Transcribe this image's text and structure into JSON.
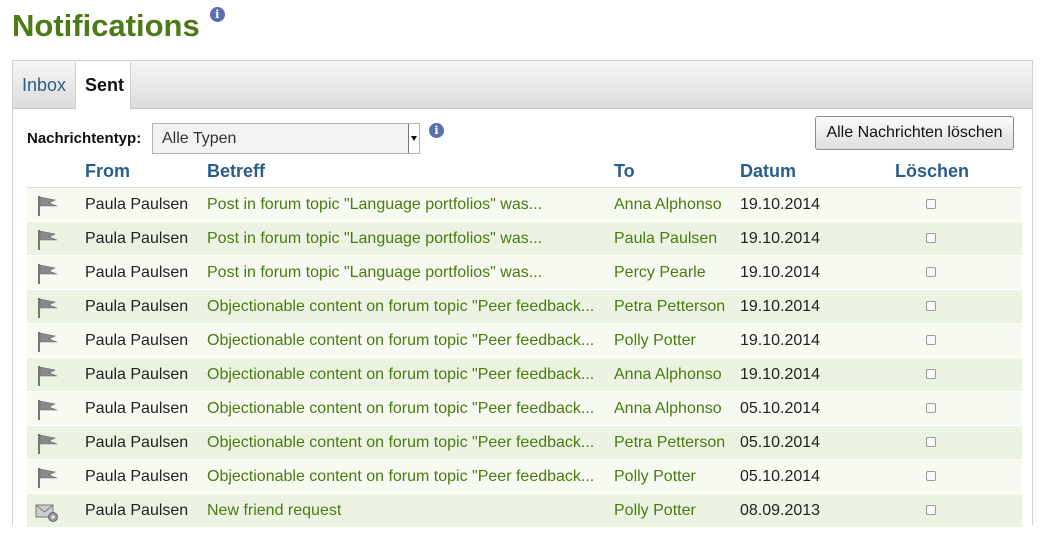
{
  "page": {
    "title": "Notifications"
  },
  "tabs": [
    {
      "label": "Inbox",
      "active": false
    },
    {
      "label": "Sent",
      "active": true
    }
  ],
  "filter": {
    "label": "Nachrichtentyp:",
    "selected": "Alle Typen"
  },
  "actions": {
    "delete_all_label": "Alle Nachrichten löschen"
  },
  "table": {
    "headers": {
      "from": "From",
      "subject": "Betreff",
      "to": "To",
      "date": "Datum",
      "delete": "Löschen"
    },
    "rows": [
      {
        "icon": "flag-icon",
        "from": "Paula Paulsen",
        "subject": "Post in forum topic \"Language portfolios\" was...",
        "to": "Anna Alphonso",
        "date": "19.10.2014"
      },
      {
        "icon": "flag-icon",
        "from": "Paula Paulsen",
        "subject": "Post in forum topic \"Language portfolios\" was...",
        "to": "Paula Paulsen",
        "date": "19.10.2014"
      },
      {
        "icon": "flag-icon",
        "from": "Paula Paulsen",
        "subject": "Post in forum topic \"Language portfolios\" was...",
        "to": "Percy Pearle",
        "date": "19.10.2014"
      },
      {
        "icon": "flag-icon",
        "from": "Paula Paulsen",
        "subject": "Objectionable content on forum topic \"Peer feedback...",
        "to": "Petra Petterson",
        "date": "19.10.2014"
      },
      {
        "icon": "flag-icon",
        "from": "Paula Paulsen",
        "subject": "Objectionable content on forum topic \"Peer feedback...",
        "to": "Polly Potter",
        "date": "19.10.2014"
      },
      {
        "icon": "flag-icon",
        "from": "Paula Paulsen",
        "subject": "Objectionable content on forum topic \"Peer feedback...",
        "to": "Anna Alphonso",
        "date": "19.10.2014"
      },
      {
        "icon": "flag-icon",
        "from": "Paula Paulsen",
        "subject": "Objectionable content on forum topic \"Peer feedback...",
        "to": "Anna Alphonso",
        "date": "05.10.2014"
      },
      {
        "icon": "flag-icon",
        "from": "Paula Paulsen",
        "subject": "Objectionable content on forum topic \"Peer feedback...",
        "to": "Petra Petterson",
        "date": "05.10.2014"
      },
      {
        "icon": "flag-icon",
        "from": "Paula Paulsen",
        "subject": "Objectionable content on forum topic \"Peer feedback...",
        "to": "Polly Potter",
        "date": "05.10.2014"
      },
      {
        "icon": "mail-settings-icon",
        "from": "Paula Paulsen",
        "subject": "New friend request",
        "to": "Polly Potter",
        "date": "08.09.2013"
      }
    ]
  }
}
